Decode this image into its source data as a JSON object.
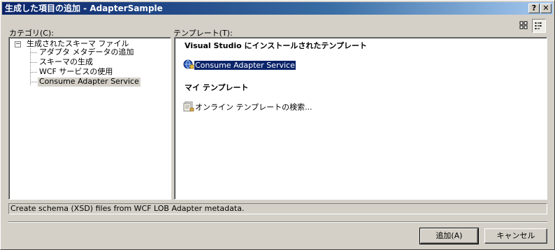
{
  "window": {
    "title": "生成した項目の追加 - AdapterSample",
    "help_label": "?",
    "close_label": "✕"
  },
  "categories": {
    "label": "カテゴリ(C):",
    "root": "生成されたスキーマ ファイル",
    "items": [
      "アダプタ メタデータの追加",
      "スキーマの生成",
      "WCF サービスの使用",
      "Consume Adapter Service"
    ],
    "selected": "Consume Adapter Service"
  },
  "templates": {
    "label": "テンプレート(T):",
    "installed_header": "Visual Studio にインストールされたテンプレート",
    "installed_items": [
      "Consume Adapter Service"
    ],
    "my_header": "マイ テンプレート",
    "my_items": [
      "オンライン テンプレートの検索..."
    ],
    "view_large_icon": "grid-icon",
    "view_small_icon": "list-icon",
    "active_view": "small-icons"
  },
  "status": {
    "description": "Create schema (XSD) files from WCF LOB Adapter metadata."
  },
  "buttons": {
    "add": "追加(A)",
    "cancel": "キャンセル"
  },
  "colors": {
    "titlebar_start": "#0a246a",
    "titlebar_end": "#a6caf0",
    "selection": "#0a246a",
    "face": "#d4d0c8"
  }
}
